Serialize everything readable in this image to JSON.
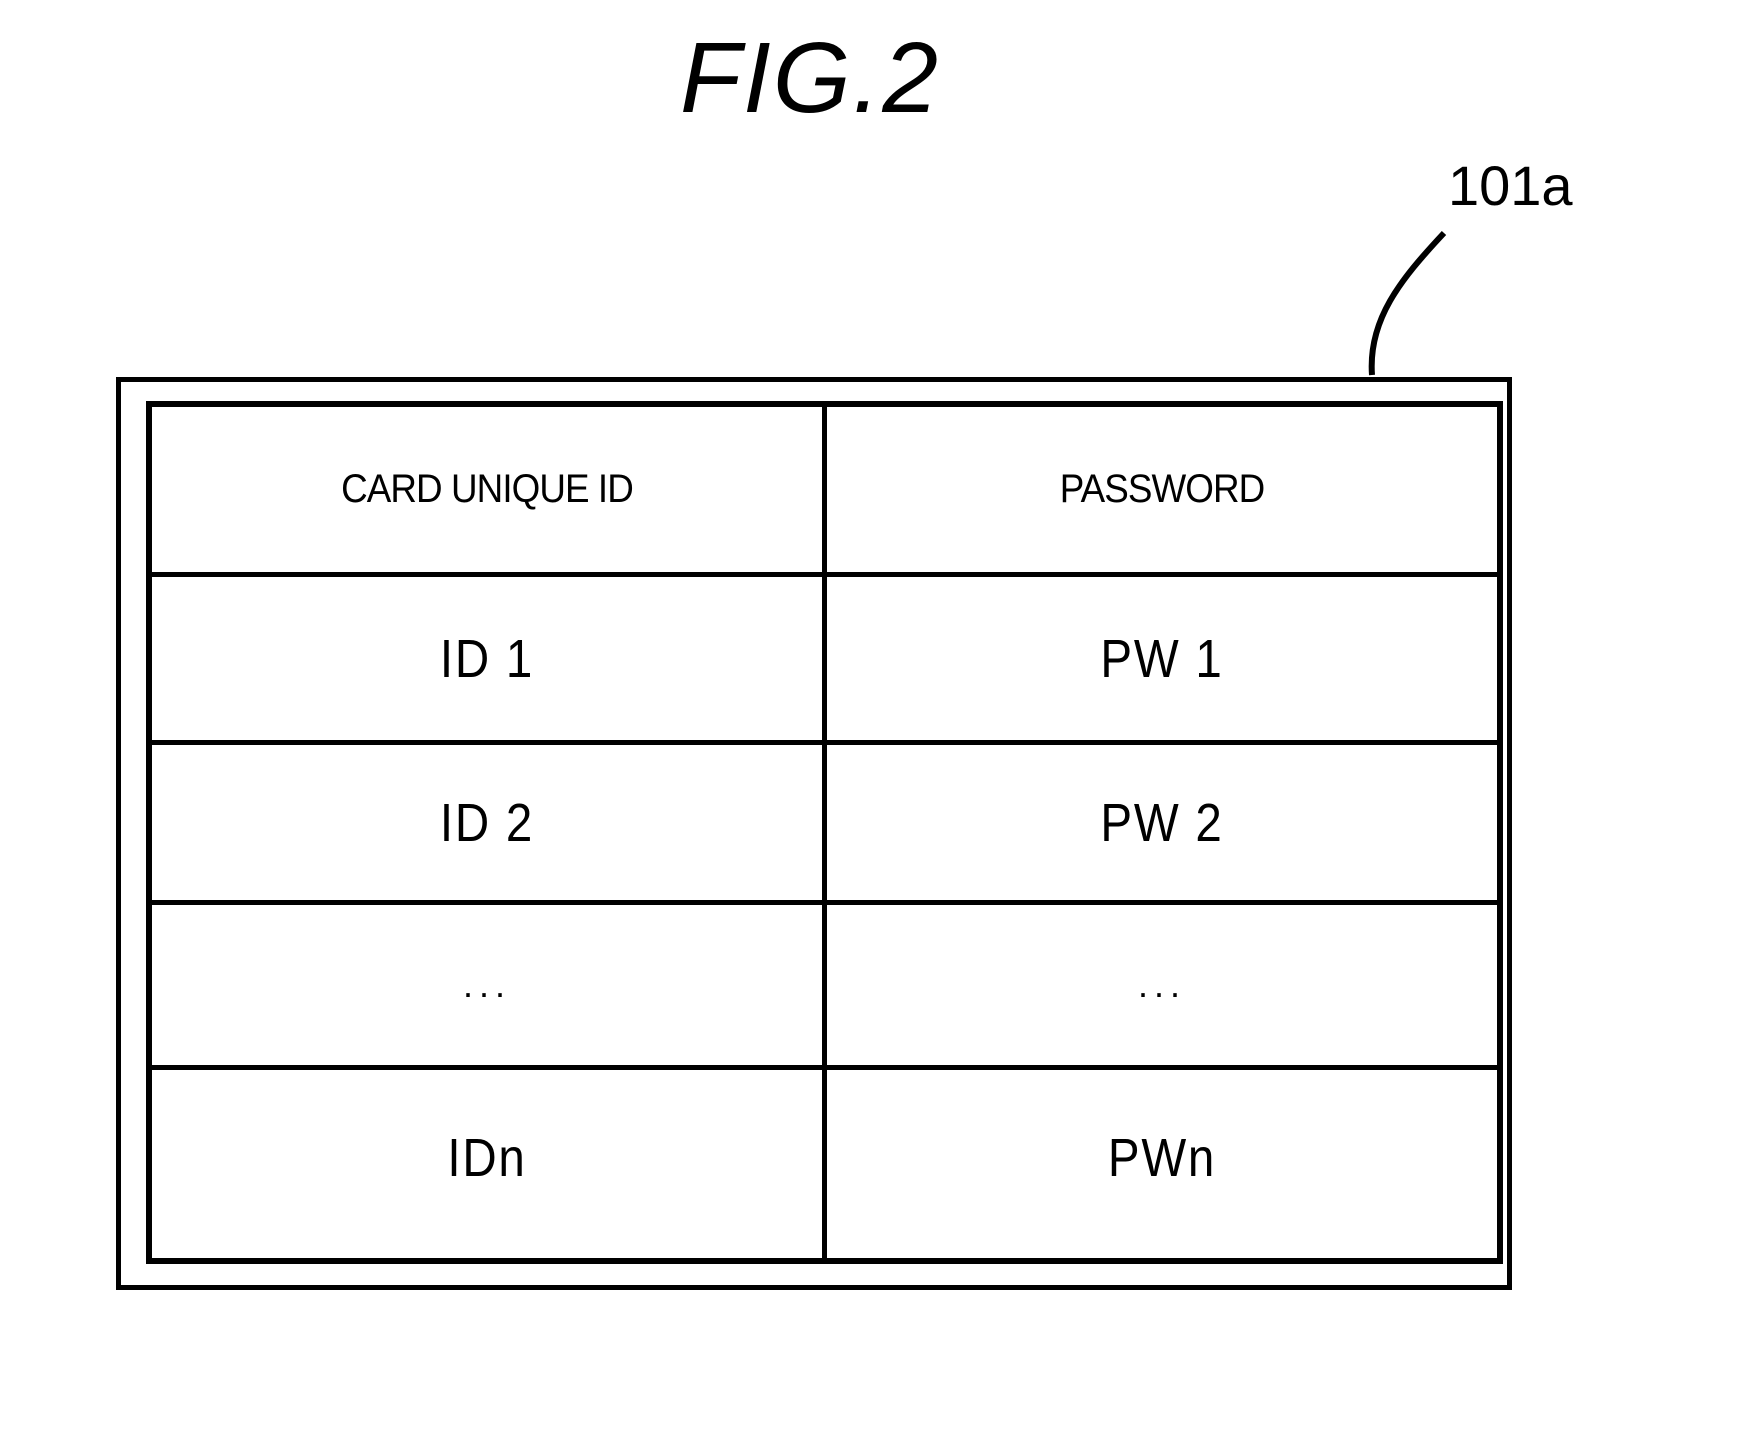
{
  "figure": {
    "title": "FIG.2",
    "reference_label": "101a"
  },
  "table": {
    "columns": [
      "CARD UNIQUE ID",
      "PASSWORD"
    ],
    "rows": [
      [
        "ID 1",
        "PW 1"
      ],
      [
        "ID 2",
        "PW 2"
      ],
      [
        "...",
        "..."
      ],
      [
        "IDn",
        "PWn"
      ]
    ]
  }
}
